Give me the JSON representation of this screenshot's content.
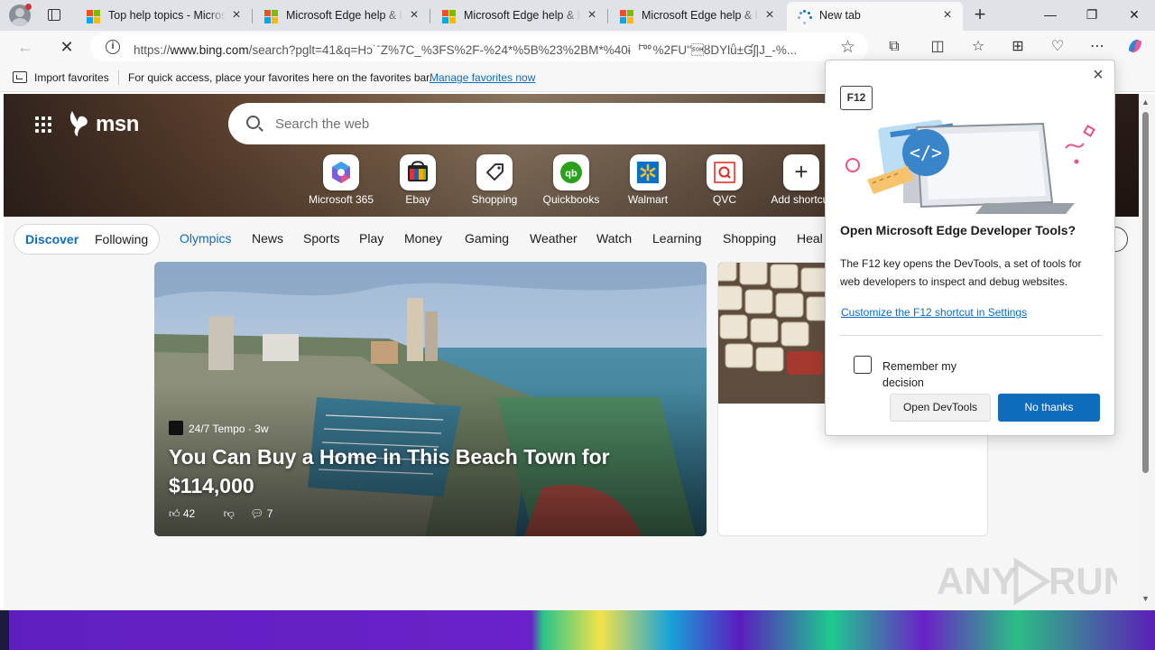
{
  "browser": {
    "tabs": [
      {
        "title": "Top help topics - Microsoft Edge",
        "active": false
      },
      {
        "title": "Microsoft Edge help & learning",
        "active": false
      },
      {
        "title": "Microsoft Edge help & learning",
        "active": false
      },
      {
        "title": "Microsoft Edge help & learning",
        "active": false
      },
      {
        "title": "New tab",
        "active": true
      }
    ],
    "new_tab_symbol": "+",
    "window_controls": {
      "minimize": "—",
      "maximize": "❐",
      "close": "✕"
    },
    "address_bar": {
      "url_prefix": "https://",
      "url_host": "www.bing.com",
      "url_rest": "/search?pglt=41&q=Hɔ˙ˉZ%7C_%3FS%2F-%24*%5B%23%2BM*%40ɨᅵ̄ᅇ%2FU''\u0001ȣDYlǖ±Ɠʃ|J_-%...",
      "icons": [
        "back-icon",
        "reload-icon",
        "site-info-icon",
        "favorite-star-icon",
        "extensions-icon",
        "split-screen-icon",
        "favorites-icon",
        "collections-icon",
        "performance-icon",
        "more-icon",
        "copilot-icon"
      ]
    },
    "favorites_bar": {
      "import_label": "Import favorites",
      "hint": "For quick access, place your favorites here on the favorites bar.",
      "manage_link": "Manage favorites now"
    }
  },
  "msn": {
    "logo_text": "msn",
    "search_placeholder": "Search the web",
    "quick_links": [
      {
        "label": "Microsoft 365",
        "icon": "microsoft365-icon"
      },
      {
        "label": "Ebay",
        "icon": "ebay-icon"
      },
      {
        "label": "Shopping",
        "icon": "shopping-tag-icon"
      },
      {
        "label": "Quickbooks",
        "icon": "quickbooks-icon"
      },
      {
        "label": "Walmart",
        "icon": "walmart-icon"
      },
      {
        "label": "QVC",
        "icon": "qvc-icon"
      },
      {
        "label": "Add shortcut",
        "icon": "plus-icon"
      }
    ],
    "feed_tabs": {
      "discover": "Discover",
      "following": "Following"
    },
    "nav_items": [
      "Olympics",
      "News",
      "Sports",
      "Play",
      "Money",
      "Gaming",
      "Weather",
      "Watch",
      "Learning",
      "Shopping",
      "Heal"
    ],
    "main_card": {
      "source": "24/7 Tempo",
      "age": "3w",
      "title": "You Can Buy a Home in This Beach Town for $114,000",
      "likes": "42",
      "comments": "7"
    }
  },
  "devtools_dialog": {
    "key_badge": "F12",
    "title": "Open Microsoft Edge Developer Tools?",
    "body": "The F12 key opens the DevTools, a set of tools for web developers to inspect and debug websites.",
    "settings_link": "Customize the F12 shortcut in Settings",
    "remember_label": "Remember my decision",
    "open_button": "Open DevTools",
    "cancel_button": "No thanks"
  },
  "watermark": "ANY.RUN",
  "colors": {
    "accent": "#0f6cbd",
    "tabstrip": "#dfe3e8",
    "toolbar": "#f7f7f7"
  }
}
